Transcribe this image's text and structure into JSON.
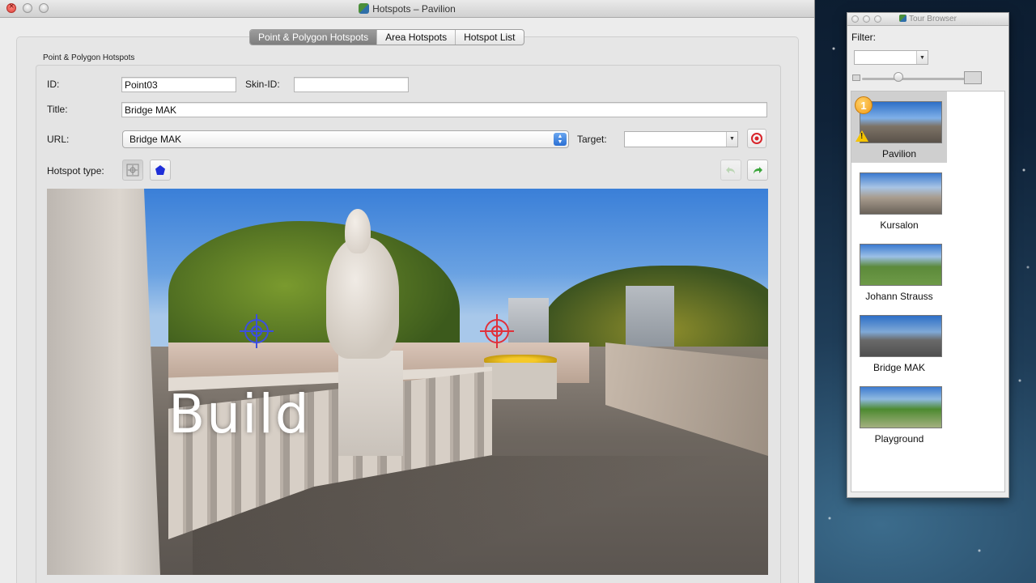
{
  "main_window": {
    "title": "Hotspots – Pavilion",
    "tabs": [
      {
        "label": "Point & Polygon Hotspots",
        "active": true
      },
      {
        "label": "Area Hotspots",
        "active": false
      },
      {
        "label": "Hotspot List",
        "active": false
      }
    ],
    "section_title": "Point & Polygon Hotspots",
    "form": {
      "id_label": "ID:",
      "id_value": "Point03",
      "skin_id_label": "Skin-ID:",
      "skin_id_value": "",
      "title_label": "Title:",
      "title_value": "Bridge MAK",
      "url_label": "URL:",
      "url_value": "Bridge MAK",
      "target_label": "Target:",
      "target_value": "",
      "hotspot_type_label": "Hotspot type:"
    },
    "viewport": {
      "overlay_text": "Build",
      "hotspot_colors": {
        "point_blue": "#3b4fe0",
        "point_red": "#e0303a"
      }
    },
    "accent_color": "#7e7e7e"
  },
  "tour_browser": {
    "title": "Tour Browser",
    "filter_label": "Filter:",
    "filter_value": "",
    "zoom_level": 0.4,
    "nodes": [
      {
        "label": "Pavilion",
        "selected": true,
        "badge": "1",
        "warning": "!"
      },
      {
        "label": "Kursalon",
        "selected": false
      },
      {
        "label": "Johann Strauss",
        "selected": false
      },
      {
        "label": "Bridge MAK",
        "selected": false
      },
      {
        "label": "Playground",
        "selected": false
      }
    ]
  }
}
